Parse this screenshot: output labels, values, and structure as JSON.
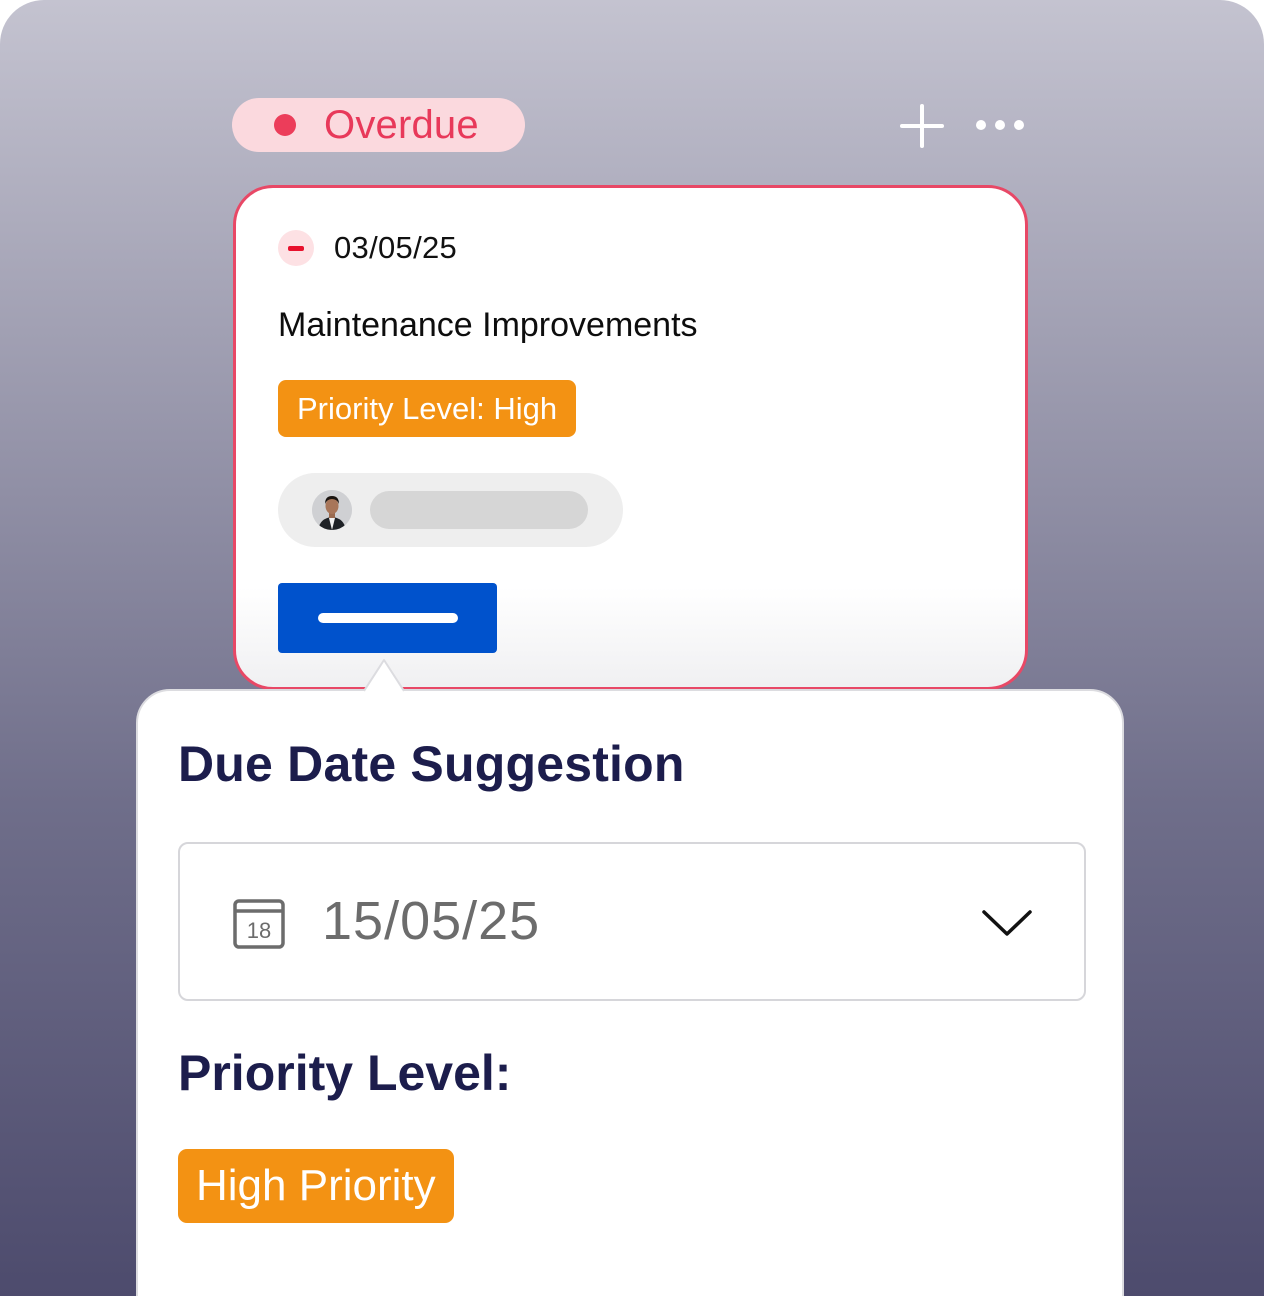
{
  "column": {
    "status_label": "Overdue",
    "add_icon": "plus-icon",
    "more_icon": "more-horizontal-icon"
  },
  "card": {
    "date": "03/05/25",
    "date_icon": "overdue-minus-icon",
    "title": "Maintenance Improvements",
    "priority": "Priority Level: High",
    "assignee_avatar": "avatar"
  },
  "suggestion": {
    "title": "Due Date Suggestion",
    "date_value": "15/05/25",
    "calendar_icon_day": "18",
    "priority_heading": "Priority Level:",
    "priority_badge": "High Priority"
  },
  "colors": {
    "overdue_red": "#e8395a",
    "priority_orange": "#f39213",
    "primary_blue": "#0052cc",
    "heading_navy": "#1c1d4c"
  }
}
